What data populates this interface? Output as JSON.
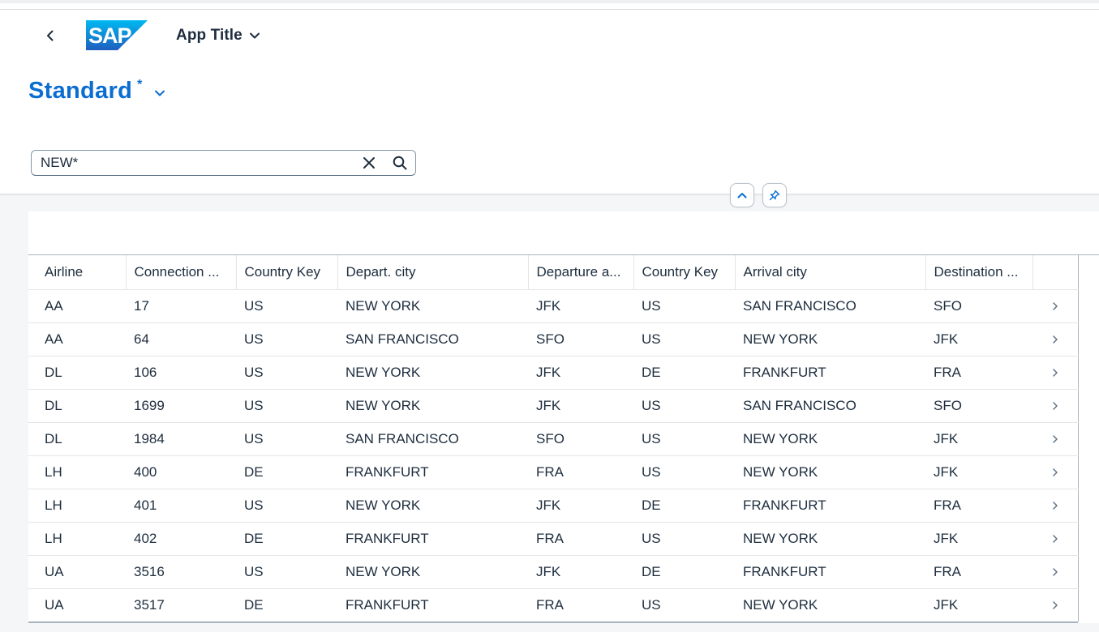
{
  "shell": {
    "app_title": "App Title",
    "logo_text": "SAP"
  },
  "variant": {
    "name": "Standard",
    "dirty_marker": "*"
  },
  "search": {
    "value": "NEW*"
  },
  "colors": {
    "accent": "#0a6ed1",
    "text": "#1d2d3e",
    "background": "#f5f6f7"
  },
  "table": {
    "columns": [
      "Airline",
      "Connection ...",
      "Country Key",
      "Depart. city",
      "Departure a...",
      "Country Key",
      "Arrival city",
      "Destination ..."
    ],
    "rows": [
      [
        "AA",
        "17",
        "US",
        "NEW YORK",
        "JFK",
        "US",
        "SAN FRANCISCO",
        "SFO"
      ],
      [
        "AA",
        "64",
        "US",
        "SAN FRANCISCO",
        "SFO",
        "US",
        "NEW YORK",
        "JFK"
      ],
      [
        "DL",
        "106",
        "US",
        "NEW YORK",
        "JFK",
        "DE",
        "FRANKFURT",
        "FRA"
      ],
      [
        "DL",
        "1699",
        "US",
        "NEW YORK",
        "JFK",
        "US",
        "SAN FRANCISCO",
        "SFO"
      ],
      [
        "DL",
        "1984",
        "US",
        "SAN FRANCISCO",
        "SFO",
        "US",
        "NEW YORK",
        "JFK"
      ],
      [
        "LH",
        "400",
        "DE",
        "FRANKFURT",
        "FRA",
        "US",
        "NEW YORK",
        "JFK"
      ],
      [
        "LH",
        "401",
        "US",
        "NEW YORK",
        "JFK",
        "DE",
        "FRANKFURT",
        "FRA"
      ],
      [
        "LH",
        "402",
        "DE",
        "FRANKFURT",
        "FRA",
        "US",
        "NEW YORK",
        "JFK"
      ],
      [
        "UA",
        "3516",
        "US",
        "NEW YORK",
        "JFK",
        "DE",
        "FRANKFURT",
        "FRA"
      ],
      [
        "UA",
        "3517",
        "DE",
        "FRANKFURT",
        "FRA",
        "US",
        "NEW YORK",
        "JFK"
      ]
    ]
  }
}
